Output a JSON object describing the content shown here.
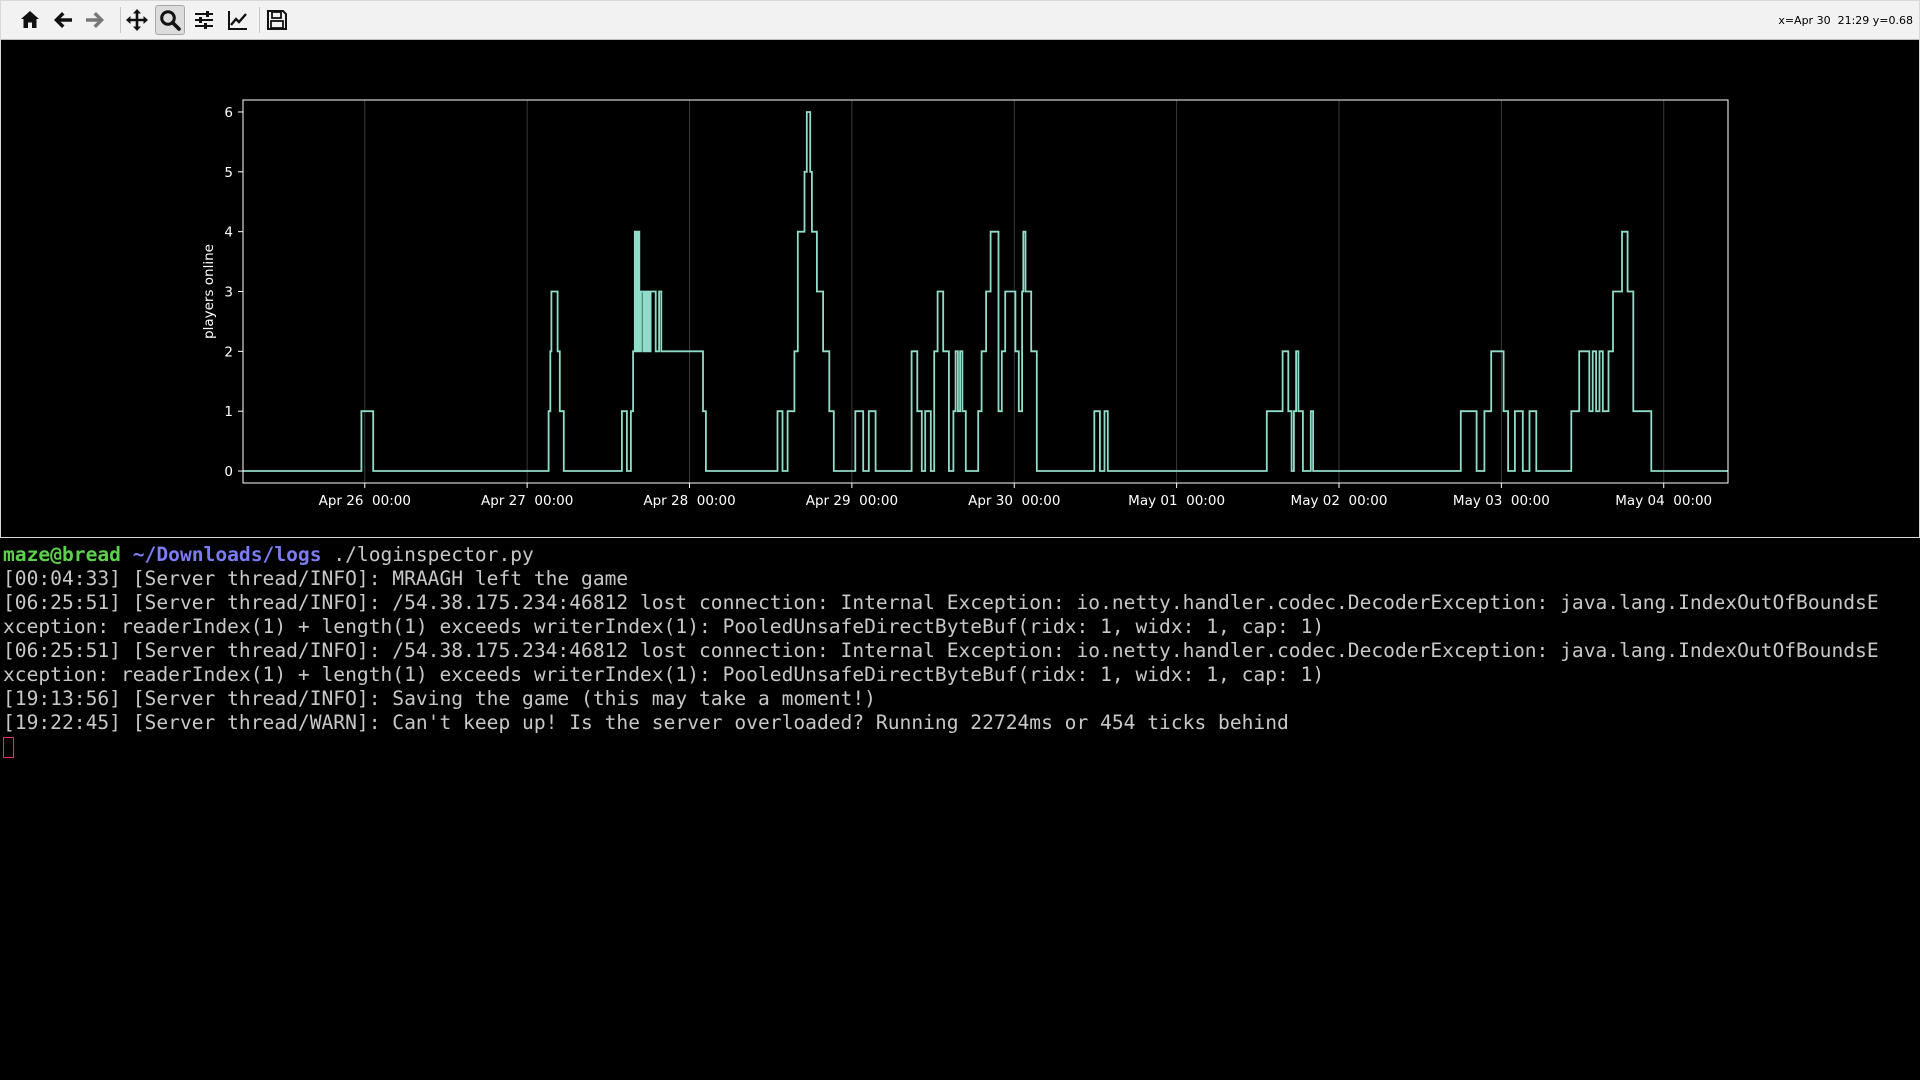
{
  "toolbar": {
    "buttons": [
      {
        "name": "home-button",
        "icon": "home-icon"
      },
      {
        "name": "back-button",
        "icon": "arrow-left-icon"
      },
      {
        "name": "forward-button",
        "icon": "arrow-right-icon"
      },
      {
        "name": "pan-button",
        "icon": "move-icon"
      },
      {
        "name": "zoom-button",
        "icon": "magnifier-icon",
        "active": true
      },
      {
        "name": "configure-subplots-button",
        "icon": "sliders-icon"
      },
      {
        "name": "edit-axes-button",
        "icon": "line-chart-icon"
      },
      {
        "name": "save-button",
        "icon": "floppy-disk-icon"
      }
    ],
    "coordinates": "x=Apr 30  21:29 y=0.68"
  },
  "chart_data": {
    "type": "line",
    "drawstyle": "steps",
    "title": "",
    "xlabel": "",
    "ylabel": "players online",
    "x_ticks": [
      "Apr 26  00:00",
      "Apr 27  00:00",
      "Apr 28  00:00",
      "Apr 29  00:00",
      "Apr 30  00:00",
      "May 01  00:00",
      "May 02  00:00",
      "May 03  00:00",
      "May 04  00:00"
    ],
    "y_ticks": [
      "0",
      "1",
      "2",
      "3",
      "4",
      "5",
      "6"
    ],
    "xlim": [
      "Apr 25  06:00",
      "May 04  09:30"
    ],
    "ylim": [
      -0.2,
      6.2
    ],
    "grid": "vertical lines at x ticks",
    "line_color": "#8fdcc9",
    "background": "#000000",
    "series": [
      {
        "points": [
          [
            "Apr 25 06:00",
            0
          ],
          [
            "Apr 25 23:30",
            1
          ],
          [
            "Apr 26 00:15",
            1
          ],
          [
            "Apr 26 00:45",
            1
          ],
          [
            "Apr 26 01:15",
            0
          ],
          [
            "Apr 27 03:10",
            1
          ],
          [
            "Apr 27 03:25",
            2
          ],
          [
            "Apr 27 03:35",
            3
          ],
          [
            "Apr 27 04:30",
            2
          ],
          [
            "Apr 27 04:50",
            1
          ],
          [
            "Apr 27 05:25",
            0
          ],
          [
            "Apr 27 14:00",
            1
          ],
          [
            "Apr 27 14:45",
            0
          ],
          [
            "Apr 27 15:20",
            1
          ],
          [
            "Apr 27 15:40",
            2
          ],
          [
            "Apr 27 15:55",
            4
          ],
          [
            "Apr 27 16:10",
            2
          ],
          [
            "Apr 27 16:20",
            4
          ],
          [
            "Apr 27 16:35",
            2
          ],
          [
            "Apr 27 16:50",
            3
          ],
          [
            "Apr 27 17:10",
            2
          ],
          [
            "Apr 27 17:20",
            3
          ],
          [
            "Apr 27 17:35",
            2
          ],
          [
            "Apr 27 17:45",
            3
          ],
          [
            "Apr 27 18:00",
            2
          ],
          [
            "Apr 27 18:15",
            3
          ],
          [
            "Apr 27 19:00",
            2
          ],
          [
            "Apr 27 19:30",
            3
          ],
          [
            "Apr 27 19:50",
            2
          ],
          [
            "Apr 27 21:20",
            2
          ],
          [
            "Apr 28 02:00",
            1
          ],
          [
            "Apr 28 02:25",
            0
          ],
          [
            "Apr 28 13:00",
            1
          ],
          [
            "Apr 28 13:45",
            0
          ],
          [
            "Apr 28 14:30",
            1
          ],
          [
            "Apr 28 15:30",
            2
          ],
          [
            "Apr 28 16:00",
            4
          ],
          [
            "Apr 28 17:00",
            5
          ],
          [
            "Apr 28 17:20",
            6
          ],
          [
            "Apr 28 17:50",
            5
          ],
          [
            "Apr 28 18:05",
            4
          ],
          [
            "Apr 28 18:50",
            3
          ],
          [
            "Apr 28 19:45",
            2
          ],
          [
            "Apr 28 20:40",
            1
          ],
          [
            "Apr 28 21:20",
            0
          ],
          [
            "Apr 29 00:30",
            1
          ],
          [
            "Apr 29 01:40",
            0
          ],
          [
            "Apr 29 02:30",
            1
          ],
          [
            "Apr 29 03:30",
            0
          ],
          [
            "Apr 29 08:50",
            2
          ],
          [
            "Apr 29 09:40",
            1
          ],
          [
            "Apr 29 10:20",
            0
          ],
          [
            "Apr 29 10:50",
            1
          ],
          [
            "Apr 29 11:40",
            0
          ],
          [
            "Apr 29 12:10",
            2
          ],
          [
            "Apr 29 12:40",
            3
          ],
          [
            "Apr 29 13:30",
            2
          ],
          [
            "Apr 29 14:20",
            0
          ],
          [
            "Apr 29 15:00",
            1
          ],
          [
            "Apr 29 15:20",
            2
          ],
          [
            "Apr 29 15:40",
            1
          ],
          [
            "Apr 29 16:00",
            2
          ],
          [
            "Apr 29 16:20",
            1
          ],
          [
            "Apr 29 16:50",
            0
          ],
          [
            "Apr 29 18:40",
            1
          ],
          [
            "Apr 29 19:10",
            2
          ],
          [
            "Apr 29 19:50",
            3
          ],
          [
            "Apr 29 20:30",
            4
          ],
          [
            "Apr 29 21:40",
            1
          ],
          [
            "Apr 29 22:10",
            2
          ],
          [
            "Apr 29 22:40",
            3
          ],
          [
            "Apr 30 00:10",
            2
          ],
          [
            "Apr 30 00:40",
            1
          ],
          [
            "Apr 30 01:10",
            3
          ],
          [
            "Apr 30 01:20",
            4
          ],
          [
            "Apr 30 01:40",
            3
          ],
          [
            "Apr 30 02:30",
            2
          ],
          [
            "Apr 30 03:20",
            0
          ],
          [
            "Apr 30 11:50",
            1
          ],
          [
            "Apr 30 12:40",
            0
          ],
          [
            "Apr 30 13:20",
            1
          ],
          [
            "Apr 30 13:50",
            0
          ],
          [
            "May 01 13:20",
            1
          ],
          [
            "May 01 15:40",
            2
          ],
          [
            "May 01 16:30",
            1
          ],
          [
            "May 01 17:00",
            0
          ],
          [
            "May 01 17:20",
            1
          ],
          [
            "May 01 17:40",
            2
          ],
          [
            "May 01 18:00",
            1
          ],
          [
            "May 01 18:40",
            0
          ],
          [
            "May 01 19:50",
            1
          ],
          [
            "May 01 20:10",
            0
          ],
          [
            "May 02 18:00",
            1
          ],
          [
            "May 02 20:20",
            0
          ],
          [
            "May 02 21:30",
            1
          ],
          [
            "May 02 22:30",
            2
          ],
          [
            "May 03 00:20",
            1
          ],
          [
            "May 03 01:00",
            0
          ],
          [
            "May 03 02:00",
            1
          ],
          [
            "May 03 03:10",
            0
          ],
          [
            "May 03 04:10",
            1
          ],
          [
            "May 03 05:10",
            0
          ],
          [
            "May 03 10:20",
            1
          ],
          [
            "May 03 11:30",
            2
          ],
          [
            "May 03 13:00",
            1
          ],
          [
            "May 03 13:30",
            2
          ],
          [
            "May 03 14:00",
            1
          ],
          [
            "May 03 14:30",
            2
          ],
          [
            "May 03 15:00",
            1
          ],
          [
            "May 03 15:50",
            2
          ],
          [
            "May 03 16:30",
            3
          ],
          [
            "May 03 17:50",
            4
          ],
          [
            "May 03 18:40",
            3
          ],
          [
            "May 03 19:30",
            1
          ],
          [
            "May 03 21:00",
            1
          ],
          [
            "May 03 22:10",
            0
          ],
          [
            "May 04 09:30",
            0
          ]
        ]
      }
    ]
  },
  "terminal": {
    "prompt_user": "maze@bread",
    "prompt_path": "~/Downloads/logs",
    "command": "./loginspector.py",
    "lines": [
      "[00:04:33] [Server thread/INFO]: MRAAGH left the game",
      "[06:25:51] [Server thread/INFO]: /54.38.175.234:46812 lost connection: Internal Exception: io.netty.handler.codec.DecoderException: java.lang.IndexOutOfBoundsE",
      "xception: readerIndex(1) + length(1) exceeds writerIndex(1): PooledUnsafeDirectByteBuf(ridx: 1, widx: 1, cap: 1)",
      "[06:25:51] [Server thread/INFO]: /54.38.175.234:46812 lost connection: Internal Exception: io.netty.handler.codec.DecoderException: java.lang.IndexOutOfBoundsE",
      "xception: readerIndex(1) + length(1) exceeds writerIndex(1): PooledUnsafeDirectByteBuf(ridx: 1, widx: 1, cap: 1)",
      "[19:13:56] [Server thread/INFO]: Saving the game (this may take a moment!)",
      "[19:22:45] [Server thread/WARN]: Can't keep up! Is the server overloaded? Running 22724ms or 454 ticks behind"
    ]
  }
}
